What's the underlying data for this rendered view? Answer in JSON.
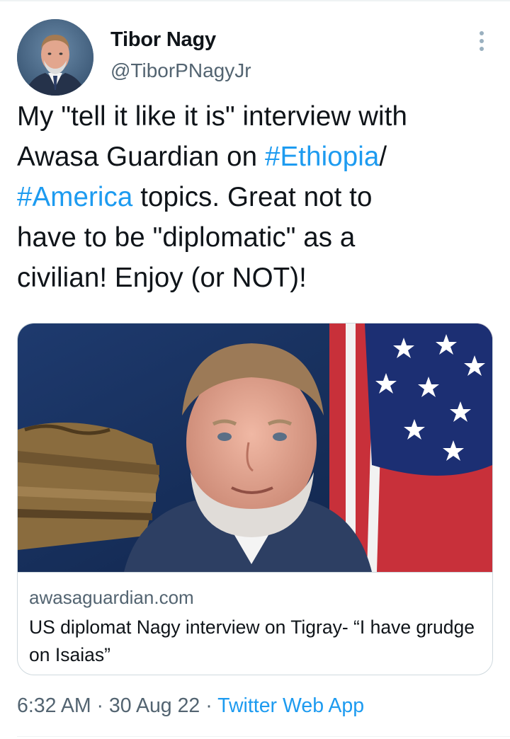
{
  "author": {
    "name": "Tibor Nagy",
    "handle": "@TiborPNagyJr",
    "avatar_icon": "profile-photo"
  },
  "tweet": {
    "lines": [
      [
        {
          "text": "My \"tell it like it is\" interview with",
          "hashtag": false
        }
      ],
      [
        {
          "text": "Awasa Guardian on ",
          "hashtag": false
        },
        {
          "text": "#Ethiopia",
          "hashtag": true
        },
        {
          "text": "/",
          "hashtag": false
        }
      ],
      [
        {
          "text": "#America",
          "hashtag": true
        },
        {
          "text": " topics. Great not to",
          "hashtag": false
        }
      ],
      [
        {
          "text": "have to be \"diplomatic\" as a",
          "hashtag": false
        }
      ],
      [
        {
          "text": "civilian! Enjoy (or NOT)!",
          "hashtag": false
        }
      ]
    ]
  },
  "link_card": {
    "domain": "awasaguardian.com",
    "title": "US diplomat Nagy interview on Tigray- “I have grudge on Isaias”"
  },
  "meta": {
    "time": "6:32 AM",
    "separator": " · ",
    "date": "30 Aug 22",
    "source": "Twitter Web App"
  },
  "colors": {
    "accent": "#1d9bf0",
    "text": "#0f1419",
    "secondary": "#536471",
    "border": "#cfd9de"
  },
  "icons": {
    "more": "more-vertical-icon"
  }
}
